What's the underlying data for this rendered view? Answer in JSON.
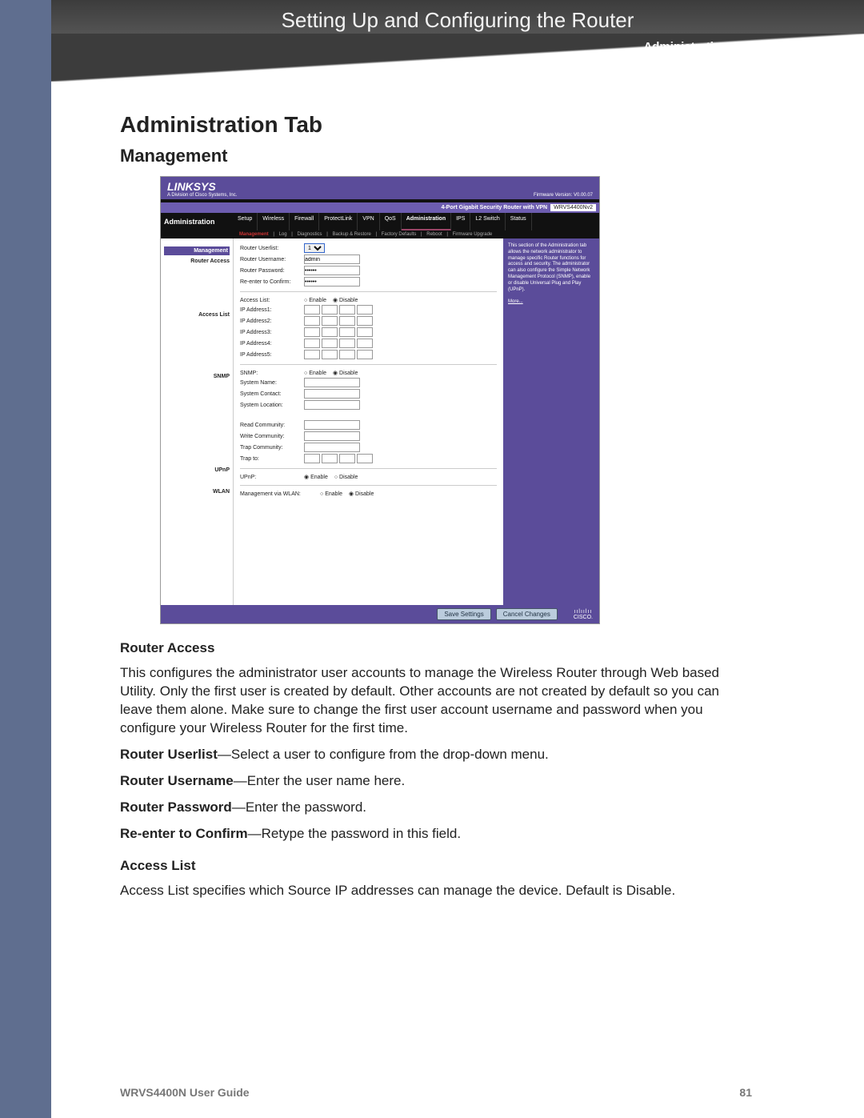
{
  "chapter": {
    "title": "Setting Up and Configuring the Router",
    "subtitle": "Administration Tab"
  },
  "section": {
    "h1": "Administration Tab",
    "h2": "Management"
  },
  "ui": {
    "brand": "LINKSYS",
    "subbrand": "A Division of Cisco Systems, Inc.",
    "firmware": "Firmware Version: V0.00.07",
    "model_name": "4-Port Gigabit Security Router with VPN",
    "model_num": "WRVS4400Nv2",
    "admin_label": "Administration",
    "tabs": [
      "Setup",
      "Wireless",
      "Firewall",
      "ProtectLink",
      "VPN",
      "QoS",
      "Administration",
      "IPS",
      "L2 Switch",
      "Status"
    ],
    "subtabs": [
      "Management",
      "Log",
      "Diagnostics",
      "Backup & Restore",
      "Factory Defaults",
      "Reboot",
      "Firmware Upgrade"
    ],
    "left_sections": {
      "mgmt": "Management",
      "router_access": "Router Access",
      "access_list": "Access List",
      "snmp": "SNMP",
      "upnp": "UPnP",
      "wlan": "WLAN"
    },
    "fields": {
      "router_userlist": "Router Userlist:",
      "router_username": "Router Username:",
      "router_password": "Router Password:",
      "reenter": "Re-enter to Confirm:",
      "username_val": "admin",
      "pw_val": "••••••",
      "access_list": "Access List:",
      "ip1": "IP Address1:",
      "ip2": "IP Address2:",
      "ip3": "IP Address3:",
      "ip4": "IP Address4:",
      "ip5": "IP Address5:",
      "snmp": "SNMP:",
      "sys_name": "System Name:",
      "sys_contact": "System Contact:",
      "sys_location": "System Location:",
      "read_comm": "Read Community:",
      "write_comm": "Write Community:",
      "trap_comm": "Trap Community:",
      "trap_to": "Trap to:",
      "upnp": "UPnP:",
      "mgmt_wlan": "Management via WLAN:",
      "enable": "Enable",
      "disable": "Disable"
    },
    "help": "This section of the Administration tab allows the network administrator to manage specific Router functions for access and security. The administrator can also configure the Simple Network Management Protocol (SNMP), enable or disable Universal Plug and Play (UPnP).",
    "more": "More...",
    "save": "Save Settings",
    "cancel": "Cancel Changes",
    "cisco": "CISCO."
  },
  "doc": {
    "h3a": "Router Access",
    "p1": "This configures the administrator user accounts to manage the Wireless Router through Web based Utility. Only the first user is created by default. Other accounts are not created by default so you can leave them alone. Make sure to change the first user account username and password when you configure your Wireless Router for the first time.",
    "li1b": "Router Userlist",
    "li1": "—Select a user to configure from the drop-down menu.",
    "li2b": "Router Username",
    "li2": "—Enter the user name here.",
    "li3b": "Router Password",
    "li3": "—Enter the password.",
    "li4b": "Re-enter to Confirm",
    "li4": "—Retype the password in this field.",
    "h3b": "Access List",
    "p2": "Access List specifies which Source IP addresses can manage the device. Default is Disable."
  },
  "footer": {
    "guide": "WRVS4400N User Guide",
    "page": "81"
  }
}
